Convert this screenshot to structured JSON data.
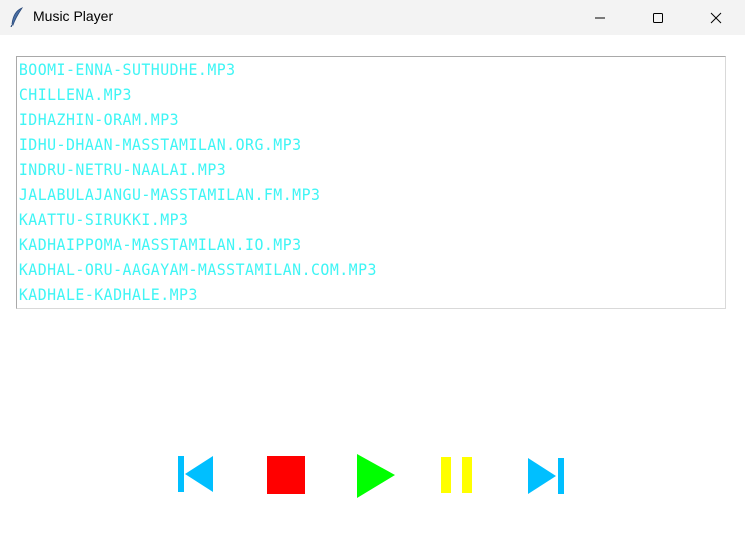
{
  "window": {
    "title": "Music Player",
    "app_icon": "feather-icon"
  },
  "titlebar_buttons": {
    "minimize_icon": "minimize-icon",
    "maximize_icon": "maximize-icon",
    "close_icon": "close-icon"
  },
  "playlist": {
    "items": [
      "BOOMI-ENNA-SUTHUDHE.MP3",
      "CHILLENA.MP3",
      "IDHAZHIN-ORAM.MP3",
      "IDHU-DHAAN-MASSTAMILAN.ORG.MP3",
      "INDRU-NETRU-NAALAI.MP3",
      "JALABULAJANGU-MASSTAMILAN.FM.MP3",
      "KAATTU-SIRUKKI.MP3",
      "KADHAIPPOMA-MASSTAMILAN.IO.MP3",
      "KADHAL-ORU-AAGAYAM-MASSTAMILAN.COM.MP3",
      "KADHALE-KADHALE.MP3"
    ],
    "text_color": "#3ff5f5"
  },
  "controls": {
    "previous": {
      "icon": "skip-previous-icon",
      "color": "#00bfff"
    },
    "stop": {
      "icon": "stop-icon",
      "color": "#ff0000"
    },
    "play": {
      "icon": "play-icon",
      "color": "#00ff00"
    },
    "pause": {
      "icon": "pause-icon",
      "color": "#ffff00"
    },
    "next": {
      "icon": "skip-next-icon",
      "color": "#00bfff"
    }
  }
}
